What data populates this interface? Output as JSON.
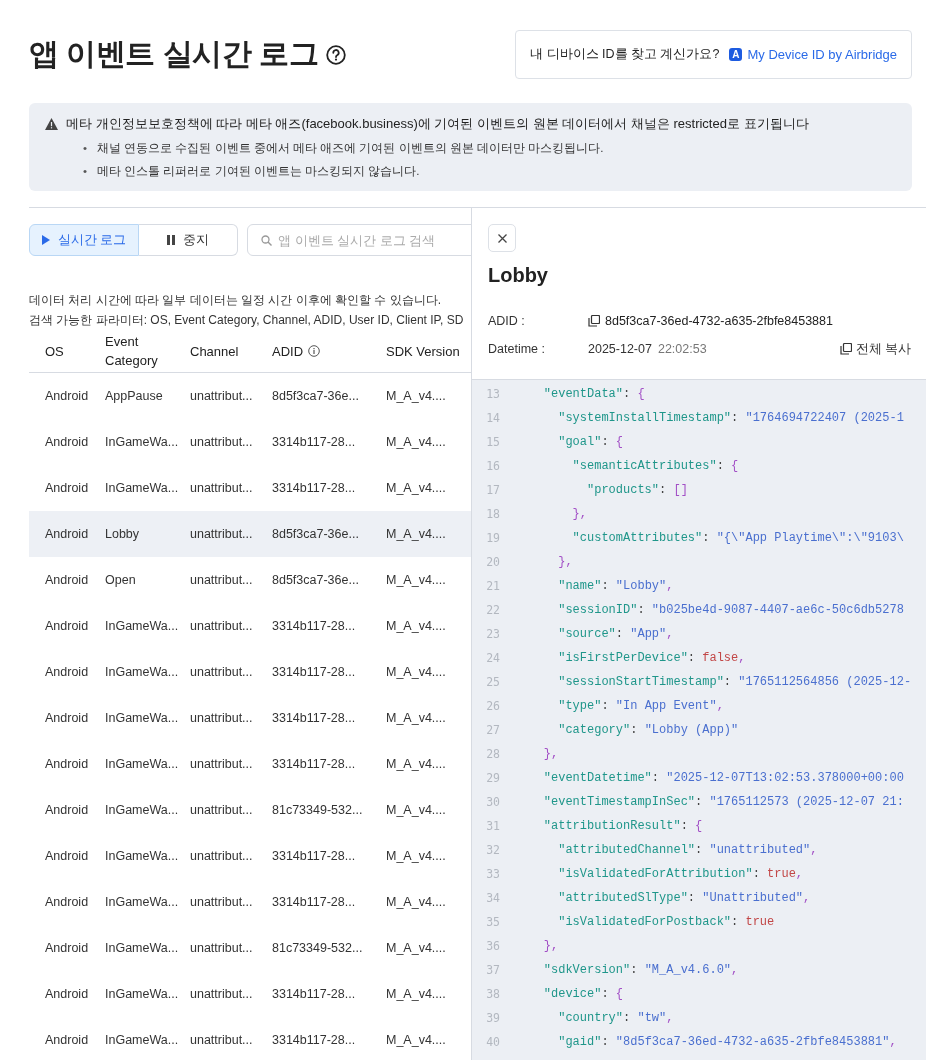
{
  "header": {
    "title": "앱 이벤트 실시간 로그",
    "device_prompt": {
      "text": "내 디바이스 ID를 찾고 계신가요?",
      "logo_letter": "A",
      "link": "My Device ID by Airbridge"
    }
  },
  "notice": {
    "bullet_marker": "•",
    "title": "메타 개인정보보호정책에 따라 메타 애즈(facebook.business)에 기여된 이벤트의 원본 데이터에서 채널은 restricted로 표기됩니다",
    "bullets": [
      "채널 연동으로 수집된 이벤트 중에서 메타 애즈에 기여된 이벤트의 원본 데이터만 마스킹됩니다.",
      "메타 인스톨 리퍼러로 기여된 이벤트는 마스킹되지 않습니다."
    ]
  },
  "toolbar": {
    "modes": [
      {
        "kind": "play",
        "label": "실시간 로그",
        "selected": true
      },
      {
        "kind": "pause",
        "label": "중지",
        "selected": false
      }
    ],
    "search": {
      "placeholder": "앱 이벤트 실시간 로그 검색"
    }
  },
  "info_lines": [
    "데이터 처리 시간에 따라 일부 데이터는 일정 시간 이후에 확인할 수 있습니다.",
    "검색 가능한 파라미터: OS, Event Category, Channel, ADID, User ID, Client IP, SD"
  ],
  "table": {
    "columns": [
      {
        "label": "OS",
        "info": false
      },
      {
        "label": "Event Category",
        "info": false
      },
      {
        "label": "Channel",
        "info": false
      },
      {
        "label": "ADID",
        "info": true
      },
      {
        "label": "SDK Version",
        "info": false
      }
    ],
    "rows": [
      {
        "cells": [
          "Android",
          "AppPause",
          "unattribut...",
          "8d5f3ca7-36e...",
          "M_A_v4...."
        ],
        "selected": false
      },
      {
        "cells": [
          "Android",
          "InGameWa...",
          "unattribut...",
          "3314b117-28...",
          "M_A_v4...."
        ],
        "selected": false
      },
      {
        "cells": [
          "Android",
          "InGameWa...",
          "unattribut...",
          "3314b117-28...",
          "M_A_v4...."
        ],
        "selected": false
      },
      {
        "cells": [
          "Android",
          "Lobby",
          "unattribut...",
          "8d5f3ca7-36e...",
          "M_A_v4...."
        ],
        "selected": true
      },
      {
        "cells": [
          "Android",
          "Open",
          "unattribut...",
          "8d5f3ca7-36e...",
          "M_A_v4...."
        ],
        "selected": false
      },
      {
        "cells": [
          "Android",
          "InGameWa...",
          "unattribut...",
          "3314b117-28...",
          "M_A_v4...."
        ],
        "selected": false
      },
      {
        "cells": [
          "Android",
          "InGameWa...",
          "unattribut...",
          "3314b117-28...",
          "M_A_v4...."
        ],
        "selected": false
      },
      {
        "cells": [
          "Android",
          "InGameWa...",
          "unattribut...",
          "3314b117-28...",
          "M_A_v4...."
        ],
        "selected": false
      },
      {
        "cells": [
          "Android",
          "InGameWa...",
          "unattribut...",
          "3314b117-28...",
          "M_A_v4...."
        ],
        "selected": false
      },
      {
        "cells": [
          "Android",
          "InGameWa...",
          "unattribut...",
          "81c73349-532...",
          "M_A_v4...."
        ],
        "selected": false
      },
      {
        "cells": [
          "Android",
          "InGameWa...",
          "unattribut...",
          "3314b117-28...",
          "M_A_v4...."
        ],
        "selected": false
      },
      {
        "cells": [
          "Android",
          "InGameWa...",
          "unattribut...",
          "3314b117-28...",
          "M_A_v4...."
        ],
        "selected": false
      },
      {
        "cells": [
          "Android",
          "InGameWa...",
          "unattribut...",
          "81c73349-532...",
          "M_A_v4...."
        ],
        "selected": false
      },
      {
        "cells": [
          "Android",
          "InGameWa...",
          "unattribut...",
          "3314b117-28...",
          "M_A_v4...."
        ],
        "selected": false
      },
      {
        "cells": [
          "Android",
          "InGameWa...",
          "unattribut...",
          "3314b117-28...",
          "M_A_v4...."
        ],
        "selected": false
      }
    ]
  },
  "detail": {
    "title": "Lobby",
    "adid_label": "ADID :",
    "adid": "8d5f3ca7-36ed-4732-a635-2fbfe8453881",
    "datetime_label": "Datetime :",
    "date": "2025-12-07",
    "time": "22:02:53",
    "copy_all": "전체 복사",
    "code_lines": [
      {
        "number": "13",
        "tokens": [
          {
            "kind": "key",
            "text": "    \"eventData\""
          },
          {
            "kind": "punct",
            "text": ": "
          },
          {
            "kind": "bracket",
            "text": "{"
          }
        ]
      },
      {
        "number": "14",
        "tokens": [
          {
            "kind": "key",
            "text": "      \"systemInstallTimestamp\""
          },
          {
            "kind": "punct",
            "text": ": "
          },
          {
            "kind": "string",
            "text": "\"1764694722407 (2025-1"
          }
        ]
      },
      {
        "number": "15",
        "tokens": [
          {
            "kind": "key",
            "text": "      \"goal\""
          },
          {
            "kind": "punct",
            "text": ": "
          },
          {
            "kind": "bracket",
            "text": "{"
          }
        ]
      },
      {
        "number": "16",
        "tokens": [
          {
            "kind": "key",
            "text": "        \"semanticAttributes\""
          },
          {
            "kind": "punct",
            "text": ": "
          },
          {
            "kind": "bracket",
            "text": "{"
          }
        ]
      },
      {
        "number": "17",
        "tokens": [
          {
            "kind": "key",
            "text": "          \"products\""
          },
          {
            "kind": "punct",
            "text": ": "
          },
          {
            "kind": "bracket",
            "text": "[]"
          }
        ]
      },
      {
        "number": "18",
        "tokens": [
          {
            "kind": "bracket",
            "text": "        },"
          }
        ]
      },
      {
        "number": "19",
        "tokens": [
          {
            "kind": "key",
            "text": "        \"customAttributes\""
          },
          {
            "kind": "punct",
            "text": ": "
          },
          {
            "kind": "string",
            "text": "\"{\\\"App Playtime\\\":\\\"9103\\"
          }
        ]
      },
      {
        "number": "20",
        "tokens": [
          {
            "kind": "bracket",
            "text": "      },"
          }
        ]
      },
      {
        "number": "21",
        "tokens": [
          {
            "kind": "key",
            "text": "      \"name\""
          },
          {
            "kind": "punct",
            "text": ": "
          },
          {
            "kind": "string",
            "text": "\"Lobby\""
          },
          {
            "kind": "bracket",
            "text": ","
          }
        ]
      },
      {
        "number": "22",
        "tokens": [
          {
            "kind": "key",
            "text": "      \"sessionID\""
          },
          {
            "kind": "punct",
            "text": ": "
          },
          {
            "kind": "string",
            "text": "\"b025be4d-9087-4407-ae6c-50c6db5278"
          }
        ]
      },
      {
        "number": "23",
        "tokens": [
          {
            "kind": "key",
            "text": "      \"source\""
          },
          {
            "kind": "punct",
            "text": ": "
          },
          {
            "kind": "string",
            "text": "\"App\""
          },
          {
            "kind": "bracket",
            "text": ","
          }
        ]
      },
      {
        "number": "24",
        "tokens": [
          {
            "kind": "key",
            "text": "      \"isFirstPerDevice\""
          },
          {
            "kind": "punct",
            "text": ": "
          },
          {
            "kind": "bool",
            "text": "false"
          },
          {
            "kind": "bracket",
            "text": ","
          }
        ]
      },
      {
        "number": "25",
        "tokens": [
          {
            "kind": "key",
            "text": "      \"sessionStartTimestamp\""
          },
          {
            "kind": "punct",
            "text": ": "
          },
          {
            "kind": "string",
            "text": "\"1765112564856 (2025-12-"
          }
        ]
      },
      {
        "number": "26",
        "tokens": [
          {
            "kind": "key",
            "text": "      \"type\""
          },
          {
            "kind": "punct",
            "text": ": "
          },
          {
            "kind": "string",
            "text": "\"In App Event\""
          },
          {
            "kind": "bracket",
            "text": ","
          }
        ]
      },
      {
        "number": "27",
        "tokens": [
          {
            "kind": "key",
            "text": "      \"category\""
          },
          {
            "kind": "punct",
            "text": ": "
          },
          {
            "kind": "string",
            "text": "\"Lobby (App)\""
          }
        ]
      },
      {
        "number": "28",
        "tokens": [
          {
            "kind": "bracket",
            "text": "    },"
          }
        ]
      },
      {
        "number": "29",
        "tokens": [
          {
            "kind": "key",
            "text": "    \"eventDatetime\""
          },
          {
            "kind": "punct",
            "text": ": "
          },
          {
            "kind": "string",
            "text": "\"2025-12-07T13:02:53.378000+00:00"
          }
        ]
      },
      {
        "number": "30",
        "tokens": [
          {
            "kind": "key",
            "text": "    \"eventTimestampInSec\""
          },
          {
            "kind": "punct",
            "text": ": "
          },
          {
            "kind": "string",
            "text": "\"1765112573 (2025-12-07 21:"
          }
        ]
      },
      {
        "number": "31",
        "tokens": [
          {
            "kind": "key",
            "text": "    \"attributionResult\""
          },
          {
            "kind": "punct",
            "text": ": "
          },
          {
            "kind": "bracket",
            "text": "{"
          }
        ]
      },
      {
        "number": "32",
        "tokens": [
          {
            "kind": "key",
            "text": "      \"attributedChannel\""
          },
          {
            "kind": "punct",
            "text": ": "
          },
          {
            "kind": "string",
            "text": "\"unattributed\""
          },
          {
            "kind": "bracket",
            "text": ","
          }
        ]
      },
      {
        "number": "33",
        "tokens": [
          {
            "kind": "key",
            "text": "      \"isValidatedForAttribution\""
          },
          {
            "kind": "punct",
            "text": ": "
          },
          {
            "kind": "bool",
            "text": "true"
          },
          {
            "kind": "bracket",
            "text": ","
          }
        ]
      },
      {
        "number": "34",
        "tokens": [
          {
            "kind": "key",
            "text": "      \"attributedSlType\""
          },
          {
            "kind": "punct",
            "text": ": "
          },
          {
            "kind": "string",
            "text": "\"Unattributed\""
          },
          {
            "kind": "bracket",
            "text": ","
          }
        ]
      },
      {
        "number": "35",
        "tokens": [
          {
            "kind": "key",
            "text": "      \"isValidatedForPostback\""
          },
          {
            "kind": "punct",
            "text": ": "
          },
          {
            "kind": "bool",
            "text": "true"
          }
        ]
      },
      {
        "number": "36",
        "tokens": [
          {
            "kind": "bracket",
            "text": "    },"
          }
        ]
      },
      {
        "number": "37",
        "tokens": [
          {
            "kind": "key",
            "text": "    \"sdkVersion\""
          },
          {
            "kind": "punct",
            "text": ": "
          },
          {
            "kind": "string",
            "text": "\"M_A_v4.6.0\""
          },
          {
            "kind": "bracket",
            "text": ","
          }
        ]
      },
      {
        "number": "38",
        "tokens": [
          {
            "kind": "key",
            "text": "    \"device\""
          },
          {
            "kind": "punct",
            "text": ": "
          },
          {
            "kind": "bracket",
            "text": "{"
          }
        ]
      },
      {
        "number": "39",
        "tokens": [
          {
            "kind": "key",
            "text": "      \"country\""
          },
          {
            "kind": "punct",
            "text": ": "
          },
          {
            "kind": "string",
            "text": "\"tw\""
          },
          {
            "kind": "bracket",
            "text": ","
          }
        ]
      },
      {
        "number": "40",
        "tokens": [
          {
            "kind": "key",
            "text": "      \"gaid\""
          },
          {
            "kind": "punct",
            "text": ": "
          },
          {
            "kind": "string",
            "text": "\"8d5f3ca7-36ed-4732-a635-2fbfe8453881\""
          },
          {
            "kind": "bracket",
            "text": ","
          }
        ]
      }
    ]
  }
}
